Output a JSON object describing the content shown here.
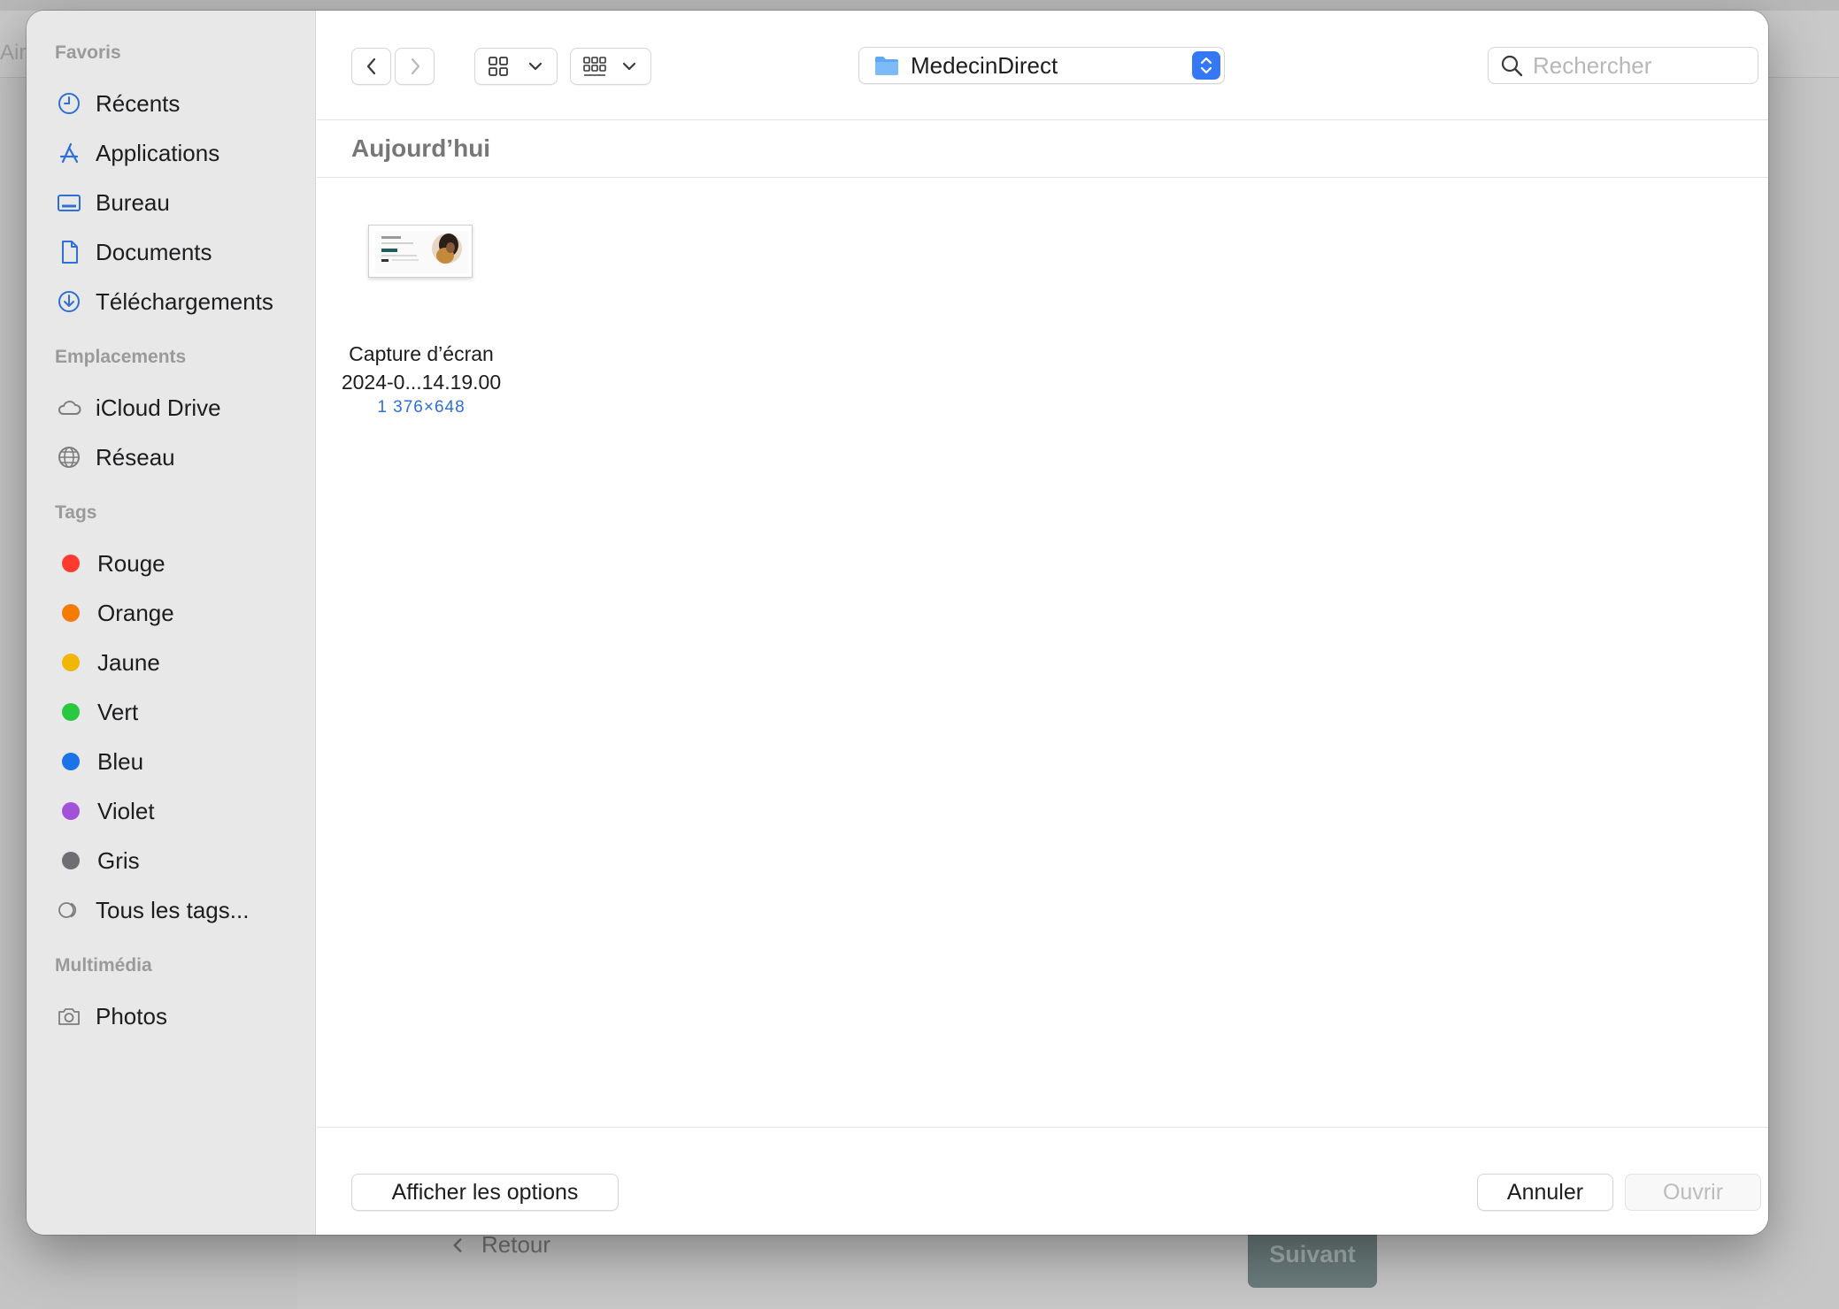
{
  "background": {
    "header_text": "Airt",
    "back_label": "Retour",
    "next_label": "Suivant"
  },
  "sidebar": {
    "favorites_title": "Favoris",
    "favorites": [
      {
        "label": "Récents",
        "icon": "clock-icon"
      },
      {
        "label": "Applications",
        "icon": "applications-icon"
      },
      {
        "label": "Bureau",
        "icon": "desktop-icon"
      },
      {
        "label": "Documents",
        "icon": "document-icon"
      },
      {
        "label": "Téléchargements",
        "icon": "download-icon"
      }
    ],
    "locations_title": "Emplacements",
    "locations": [
      {
        "label": "iCloud Drive",
        "icon": "cloud-icon"
      },
      {
        "label": "Réseau",
        "icon": "network-globe-icon"
      }
    ],
    "tags_title": "Tags",
    "tags": [
      {
        "label": "Rouge",
        "color": "#ff3b30"
      },
      {
        "label": "Orange",
        "color": "#f57c00"
      },
      {
        "label": "Jaune",
        "color": "#f2b705"
      },
      {
        "label": "Vert",
        "color": "#28c840"
      },
      {
        "label": "Bleu",
        "color": "#1a73e8"
      },
      {
        "label": "Violet",
        "color": "#a550d8"
      },
      {
        "label": "Gris",
        "color": "#6e6e73"
      }
    ],
    "all_tags_label": "Tous les tags...",
    "media_title": "Multimédia",
    "media": [
      {
        "label": "Photos",
        "icon": "camera-icon"
      }
    ]
  },
  "toolbar": {
    "current_folder": "MedecinDirect",
    "search_placeholder": "Rechercher"
  },
  "content": {
    "group_title": "Aujourd’hui",
    "files": [
      {
        "name_line1": "Capture d’écran",
        "name_line2": "2024-0...14.19.00",
        "meta": "1 376×648"
      }
    ]
  },
  "footer": {
    "options_label": "Afficher les options",
    "cancel_label": "Annuler",
    "open_label": "Ouvrir"
  }
}
